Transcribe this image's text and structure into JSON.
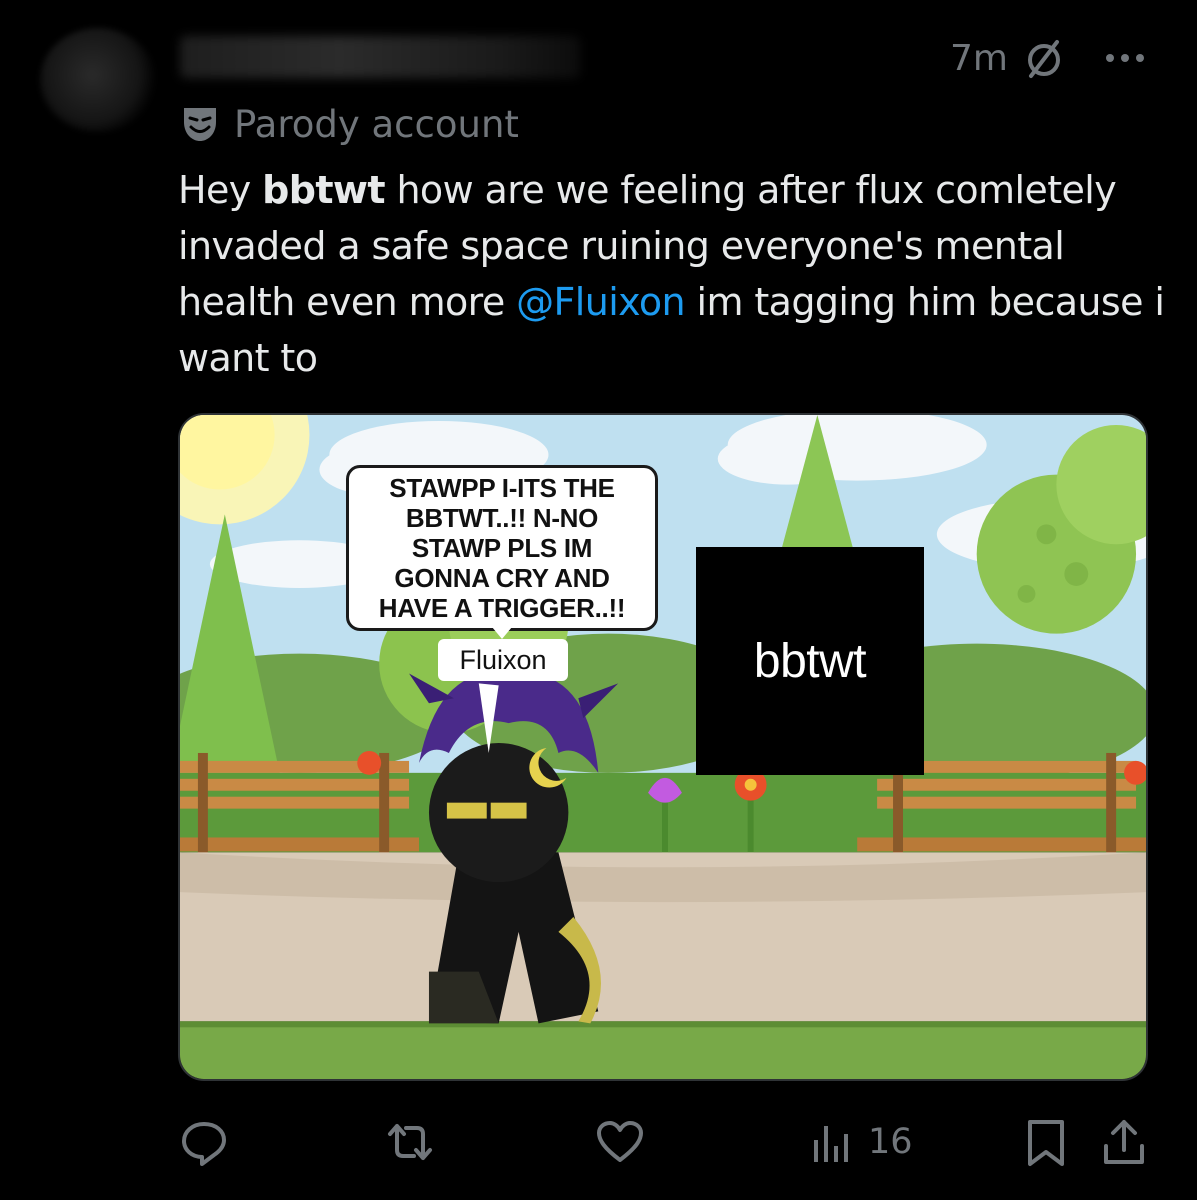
{
  "header": {
    "timestamp": "7m",
    "grok_icon": "slash-circle-icon",
    "more_icon": "more-dots-icon"
  },
  "parody": {
    "icon": "theater-mask-icon",
    "label": "Parody account"
  },
  "tweet": {
    "text_part1": "Hey ",
    "bold": "bbtwt",
    "text_part2": " how are we feeling after flux comletely invaded a safe space ruining everyone's mental health even more ",
    "mention": "@Fluixon",
    "text_part3": " im tagging him because i want to"
  },
  "media": {
    "speech_bubble": "STAWPP I-ITS THE\nBBTWT..!! N-NO\nSTAWP PLS IM\nGONNA CRY AND\nHAVE A TRIGGER..!!",
    "character_name": "Fluixon",
    "box_label": "bbtwt"
  },
  "actions": {
    "reply_icon": "reply-icon",
    "repost_icon": "repost-icon",
    "like_icon": "heart-icon",
    "views_icon": "views-chart-icon",
    "views_count": "16",
    "bookmark_icon": "bookmark-icon",
    "share_icon": "share-icon"
  },
  "colors": {
    "background": "#000000",
    "text": "#e7e9ea",
    "muted": "#71767b",
    "link": "#1d9bf0"
  }
}
